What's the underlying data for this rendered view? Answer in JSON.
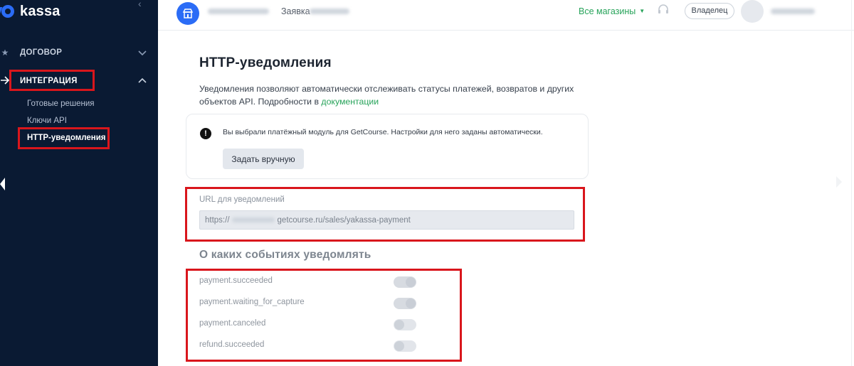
{
  "brand": {
    "name": "kassa",
    "accent": "#2b6cf6"
  },
  "sidebar": {
    "sections": [
      {
        "label": "ДОГОВОР",
        "icon": "star-icon",
        "expanded": false
      },
      {
        "label": "ИНТЕГРАЦИЯ",
        "icon": "arrow-right-icon",
        "expanded": true
      }
    ],
    "sub_items": [
      {
        "label": "Готовые решения",
        "active": false
      },
      {
        "label": "Ключи API",
        "active": false
      },
      {
        "label": "HTTP-уведомления",
        "active": true
      }
    ]
  },
  "header": {
    "app_label": "Заявка",
    "stores_label": "Все магазины",
    "role_label": "Владелец"
  },
  "main": {
    "title": "HTTP-уведомления",
    "description": "Уведомления позволяют автоматически отслеживать статусы платежей, возвратов и других объектов API. Подробности в",
    "description_link": "документации",
    "info": {
      "text": "Вы выбрали платёжный модуль для GetCourse. Настройки для него заданы автоматически.",
      "button_label": "Задать вручную"
    },
    "url": {
      "label": "URL для уведомлений",
      "prefix": "https://",
      "suffix": "getcourse.ru/sales/yakassa-payment"
    },
    "events_title": "О каких событиях уведомлять",
    "events": [
      {
        "name": "payment.succeeded",
        "enabled": true
      },
      {
        "name": "payment.waiting_for_capture",
        "enabled": true
      },
      {
        "name": "payment.canceled",
        "enabled": false
      },
      {
        "name": "refund.succeeded",
        "enabled": false
      }
    ]
  },
  "colors": {
    "sidebar_bg": "#0a1a33",
    "highlight_box": "#d9161c",
    "link": "#27a35a"
  }
}
